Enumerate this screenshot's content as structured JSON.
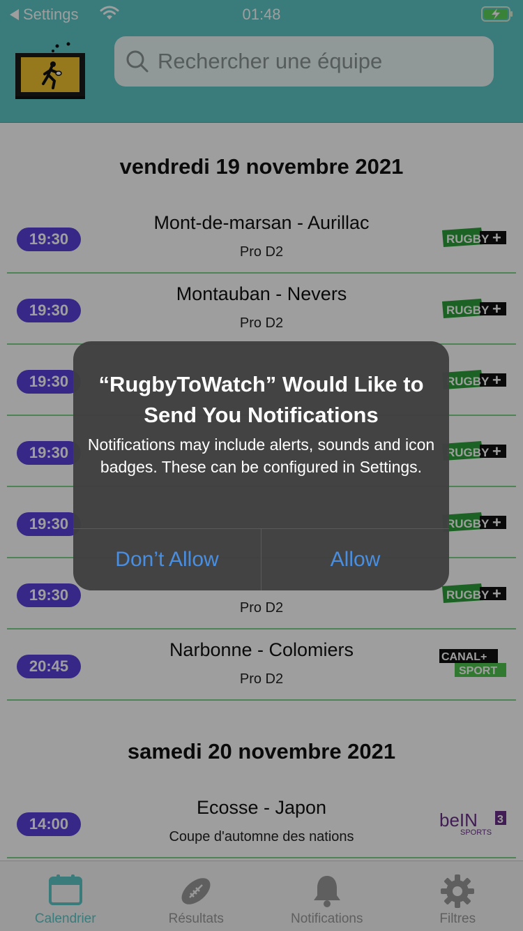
{
  "status_bar": {
    "back_label": "Settings",
    "time": "01:48"
  },
  "search": {
    "placeholder": "Rechercher une équipe"
  },
  "days": [
    {
      "date": "vendredi 19 novembre 2021"
    },
    {
      "date": "samedi 20 novembre 2021"
    }
  ],
  "matches": [
    {
      "time": "19:30",
      "teams": "Mont-de-marsan - Aurillac",
      "league": "Pro D2",
      "channel": "RUGBY+"
    },
    {
      "time": "19:30",
      "teams": "Montauban - Nevers",
      "league": "Pro D2",
      "channel": "RUGBY+"
    },
    {
      "time": "19:30",
      "teams": "",
      "league": "",
      "channel": "RUGBY+"
    },
    {
      "time": "19:30",
      "teams": "",
      "league": "",
      "channel": "RUGBY+"
    },
    {
      "time": "19:30",
      "teams": "",
      "league": "",
      "channel": "RUGBY+"
    },
    {
      "time": "19:30",
      "teams": "",
      "league": "Pro D2",
      "channel": "RUGBY+"
    },
    {
      "time": "20:45",
      "teams": "Narbonne - Colomiers",
      "league": "Pro D2",
      "channel": "CANAL+ SPORT"
    },
    {
      "time": "14:00",
      "teams": "Ecosse - Japon",
      "league": "Coupe d'automne des nations",
      "channel": "beIN SPORTS 3"
    }
  ],
  "channel_logos": {
    "rugby_plus": {
      "word": "RUGBY",
      "plus": "+"
    },
    "canal_plus": {
      "top": "CANAL+",
      "bottom": "SPORT"
    },
    "bein": {
      "brand": "beIN",
      "number": "3",
      "sub": "SPORTS"
    }
  },
  "alert": {
    "title": "“RugbyToWatch” Would Like to Send You Notifications",
    "message": "Notifications may include alerts, sounds and icon badges. These can be configured in Settings.",
    "deny_label": "Don’t Allow",
    "allow_label": "Allow"
  },
  "tabs": [
    {
      "label": "Calendrier",
      "icon": "calendar-icon",
      "active": true
    },
    {
      "label": "Résultats",
      "icon": "rugby-ball-icon",
      "active": false
    },
    {
      "label": "Notifications",
      "icon": "bell-icon",
      "active": false
    },
    {
      "label": "Filtres",
      "icon": "gear-icon",
      "active": false
    }
  ],
  "colors": {
    "header": "#5ec7c7",
    "time_pill": "#5a3fd8",
    "row_divider": "#7ed38a",
    "alert_button": "#4a8ee0",
    "active_tab": "#5ec7c7"
  }
}
